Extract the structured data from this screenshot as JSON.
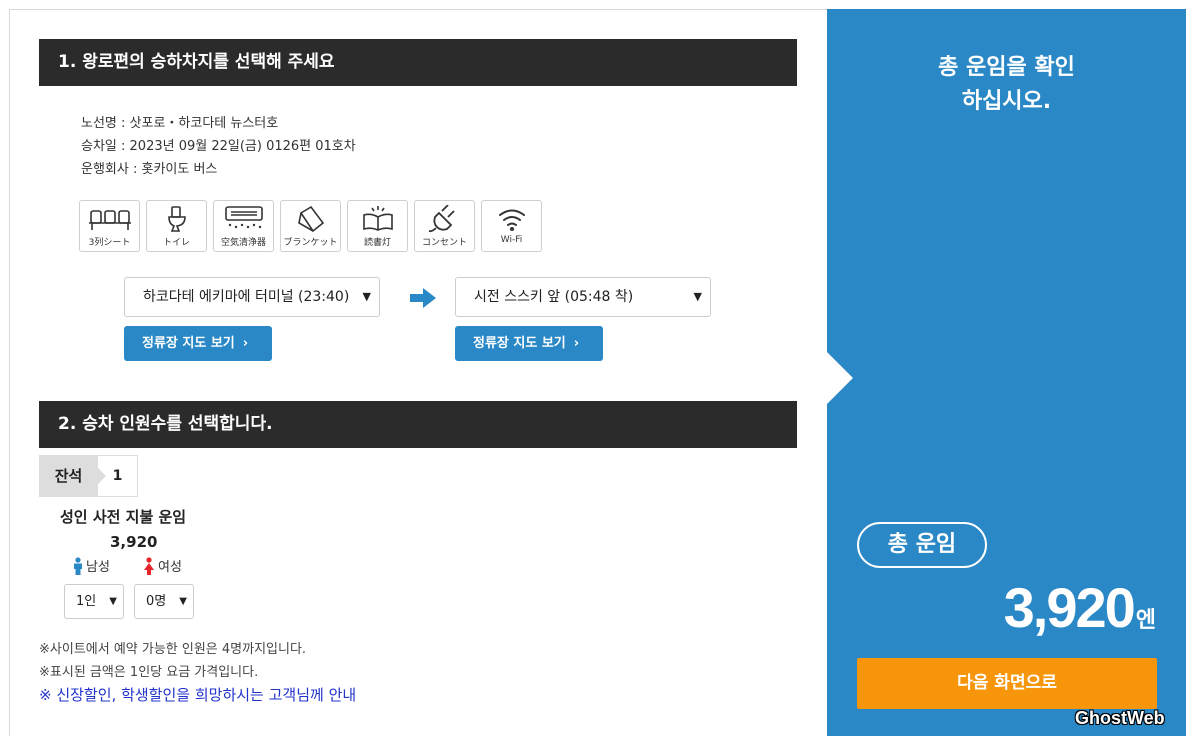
{
  "section1": {
    "title": "1. 왕로편의 승하차지를 선택해 주세요",
    "route_line": "노선명 : 삿포로・하코다테 뉴스터호",
    "date_line": "승차일 : 2023년 09월 22일(금) 0126편 01호차",
    "operator_line": "운행회사 : 홋카이도 버스"
  },
  "amenities": [
    {
      "icon": "three-row-seat-icon",
      "label": "3列シート"
    },
    {
      "icon": "toilet-icon",
      "label": "トイレ"
    },
    {
      "icon": "air-purifier-icon",
      "label": "空気清浄器"
    },
    {
      "icon": "blanket-icon",
      "label": "ブランケット"
    },
    {
      "icon": "reading-light-icon",
      "label": "読書灯"
    },
    {
      "icon": "power-outlet-icon",
      "label": "コンセント"
    },
    {
      "icon": "wifi-icon",
      "label": "Wi-Fi"
    }
  ],
  "stops": {
    "from_selected": "하코다테 에키마에 터미널 (23:40)",
    "to_selected": "시전 스스키 앞 (05:48 착)",
    "map_button_label": "정류장 지도 보기"
  },
  "section2": {
    "title": "2. 승차 인원수를 선택합니다.",
    "seat_label": "잔석",
    "seat_count": "1",
    "fare_title": "성인 사전 지불 운임",
    "fare_value": "3,920",
    "male_label": "남성",
    "female_label": "여성",
    "male_selected": "1인",
    "female_selected": "0명"
  },
  "notes": {
    "note1": "※사이트에서 예약 가능한 인원은 4명까지입니다.",
    "note2": "※표시된 금액은 1인당 요금 가격입니다.",
    "discount_link": "※ 신장할인, 학생할인을 희망하시는 고객님께 안내"
  },
  "summary": {
    "message_line1": "총 운임을 확인",
    "message_line2": "하십시오.",
    "total_label": "총 운임",
    "total_amount": "3,920",
    "currency": "엔",
    "next_button": "다음 화면으로"
  },
  "watermark": "GhostWeb",
  "colors": {
    "accent_blue": "#2a88c6",
    "header_dark": "#2b2b2b",
    "next_orange": "#f7950b",
    "male_blue": "#2a88c6",
    "female_red": "#e8232a"
  }
}
